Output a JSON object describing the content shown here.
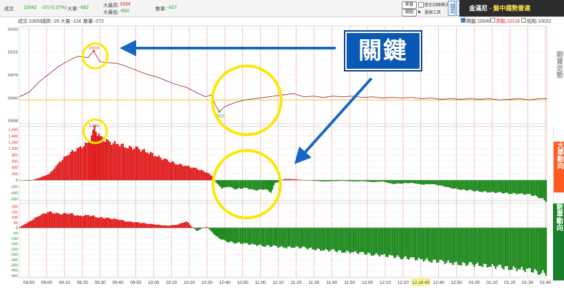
{
  "header": {
    "close_label": "成交",
    "close_value": "10042",
    "change": "-37(-0.37%)",
    "big_order_label": "大單:",
    "big_order_value": "-682",
    "big_high_label": "大最高:",
    "big_high_value": "1634",
    "big_low_label": "大最低:",
    "big_low_value": "-692",
    "small_order_label": "散單:",
    "small_order_value": "-427"
  },
  "controls": {
    "single_label": "單窗",
    "history_mode_label": "歷史訓練模式",
    "draw_label": "繪圖",
    "line_tool_label": "畫線工具",
    "settings_label": "設定",
    "exit_label": "退出"
  },
  "brand": {
    "name": "金滿尼",
    "slogan": "盤中趨勢雷達"
  },
  "subheader": {
    "trade": "成交:10050",
    "ups_downs": "漲跌:-29",
    "big": "大量:-124",
    "small": "散量:-272",
    "legend_close": "開盤:10040",
    "legend_high": "高點:10116",
    "legend_low": "低點:10022"
  },
  "side_labels": {
    "futures": "期貨走勢",
    "big": "大單動向",
    "small": "散單動向"
  },
  "annotation": {
    "text": "關鍵",
    "peak_label": "10116",
    "low_label": "10022",
    "big_peak_label": "1,634"
  },
  "chart_data": {
    "type": "line",
    "x_ticks": [
      "08:50",
      "09:00",
      "09:10",
      "09:20",
      "09:30",
      "09:40",
      "09:50",
      "10:00",
      "10:10",
      "10:20",
      "10:30",
      "10:40",
      "10:50",
      "11:00",
      "11:10",
      "11:20",
      "11:30",
      "11:40",
      "11:50",
      "12:00",
      "12:10",
      "12:20",
      "12:28:40",
      "12:40",
      "12:50",
      "01:00",
      "01:10",
      "01:20",
      "01:30",
      "01:40"
    ],
    "price": {
      "y_ticks": [
        10150,
        10115,
        10079,
        10043,
        10008
      ],
      "ylim": [
        10003,
        10155
      ],
      "ref_open": 10040,
      "high": 10116,
      "low": 10022,
      "points": [
        [
          0,
          10045
        ],
        [
          5,
          10052
        ],
        [
          10,
          10068
        ],
        [
          15,
          10080
        ],
        [
          20,
          10092
        ],
        [
          25,
          10101
        ],
        [
          30,
          10108
        ],
        [
          35,
          10106
        ],
        [
          38,
          10116
        ],
        [
          41,
          10100
        ],
        [
          45,
          10098
        ],
        [
          50,
          10097
        ],
        [
          55,
          10092
        ],
        [
          60,
          10086
        ],
        [
          65,
          10080
        ],
        [
          70,
          10076
        ],
        [
          75,
          10070
        ],
        [
          80,
          10064
        ],
        [
          85,
          10060
        ],
        [
          90,
          10052
        ],
        [
          95,
          10045
        ],
        [
          98,
          10048
        ],
        [
          100,
          10032
        ],
        [
          102,
          10022
        ],
        [
          105,
          10030
        ],
        [
          110,
          10036
        ],
        [
          115,
          10040
        ],
        [
          120,
          10042
        ],
        [
          125,
          10044
        ],
        [
          130,
          10046
        ],
        [
          135,
          10048
        ],
        [
          140,
          10050
        ],
        [
          145,
          10045
        ],
        [
          150,
          10046
        ],
        [
          155,
          10044
        ],
        [
          160,
          10046
        ],
        [
          165,
          10045
        ],
        [
          170,
          10046
        ],
        [
          175,
          10044
        ],
        [
          180,
          10045
        ],
        [
          185,
          10043
        ],
        [
          190,
          10044
        ],
        [
          195,
          10043
        ],
        [
          200,
          10044
        ],
        [
          205,
          10042
        ],
        [
          210,
          10043
        ],
        [
          215,
          10041
        ],
        [
          220,
          10042
        ],
        [
          225,
          10041
        ],
        [
          230,
          10042
        ],
        [
          235,
          10041
        ],
        [
          240,
          10042
        ],
        [
          245,
          10040
        ],
        [
          250,
          10041
        ],
        [
          255,
          10042
        ],
        [
          260,
          10040
        ],
        [
          265,
          10042
        ],
        [
          269,
          10042
        ]
      ]
    },
    "big_order": {
      "y_ticks": [
        1600,
        1400,
        1200,
        1000,
        800,
        600,
        400,
        200,
        0,
        -200,
        -400,
        -600
      ],
      "ylim": [
        -650,
        1700
      ],
      "high": 1634,
      "low": -692,
      "points": [
        [
          0,
          0
        ],
        [
          5,
          -20
        ],
        [
          10,
          80
        ],
        [
          15,
          200
        ],
        [
          20,
          560
        ],
        [
          25,
          860
        ],
        [
          30,
          1000
        ],
        [
          35,
          1200
        ],
        [
          38,
          1634
        ],
        [
          41,
          1350
        ],
        [
          45,
          1200
        ],
        [
          50,
          1150
        ],
        [
          55,
          1050
        ],
        [
          60,
          1000
        ],
        [
          65,
          900
        ],
        [
          70,
          760
        ],
        [
          75,
          620
        ],
        [
          80,
          520
        ],
        [
          85,
          450
        ],
        [
          90,
          360
        ],
        [
          95,
          260
        ],
        [
          98,
          120
        ],
        [
          100,
          -80
        ],
        [
          103,
          -260
        ],
        [
          106,
          -200
        ],
        [
          110,
          -280
        ],
        [
          115,
          -250
        ],
        [
          120,
          -320
        ],
        [
          125,
          -280
        ],
        [
          128,
          -380
        ],
        [
          130,
          -100
        ],
        [
          135,
          40
        ],
        [
          140,
          30
        ],
        [
          145,
          0
        ],
        [
          150,
          -20
        ],
        [
          155,
          -40
        ],
        [
          160,
          -30
        ],
        [
          165,
          -20
        ],
        [
          170,
          -40
        ],
        [
          175,
          -30
        ],
        [
          180,
          -60
        ],
        [
          185,
          -40
        ],
        [
          190,
          -120
        ],
        [
          195,
          -100
        ],
        [
          200,
          -90
        ],
        [
          205,
          -140
        ],
        [
          210,
          -120
        ],
        [
          215,
          -180
        ],
        [
          220,
          -250
        ],
        [
          225,
          -300
        ],
        [
          230,
          -330
        ],
        [
          235,
          -360
        ],
        [
          240,
          -380
        ],
        [
          245,
          -400
        ],
        [
          250,
          -420
        ],
        [
          255,
          -430
        ],
        [
          260,
          -460
        ],
        [
          265,
          -540
        ],
        [
          269,
          -692
        ]
      ]
    },
    "small_order": {
      "y_ticks": [
        200,
        150,
        100,
        50,
        0,
        -50,
        -100,
        -150,
        -200,
        -250,
        -300,
        -350,
        -400,
        -450
      ],
      "ylim": [
        -470,
        230
      ],
      "points": [
        [
          0,
          10
        ],
        [
          5,
          60
        ],
        [
          10,
          120
        ],
        [
          15,
          150
        ],
        [
          20,
          130
        ],
        [
          25,
          140
        ],
        [
          30,
          110
        ],
        [
          35,
          120
        ],
        [
          40,
          100
        ],
        [
          45,
          90
        ],
        [
          50,
          80
        ],
        [
          55,
          60
        ],
        [
          60,
          50
        ],
        [
          65,
          40
        ],
        [
          70,
          30
        ],
        [
          75,
          20
        ],
        [
          80,
          30
        ],
        [
          85,
          60
        ],
        [
          90,
          -30
        ],
        [
          95,
          10
        ],
        [
          98,
          -40
        ],
        [
          100,
          -80
        ],
        [
          103,
          -110
        ],
        [
          106,
          -130
        ],
        [
          110,
          -140
        ],
        [
          115,
          -150
        ],
        [
          120,
          -160
        ],
        [
          125,
          -170
        ],
        [
          130,
          -175
        ],
        [
          135,
          -185
        ],
        [
          140,
          -180
        ],
        [
          145,
          -190
        ],
        [
          150,
          -200
        ],
        [
          155,
          -210
        ],
        [
          160,
          -215
        ],
        [
          165,
          -225
        ],
        [
          170,
          -230
        ],
        [
          175,
          -240
        ],
        [
          180,
          -250
        ],
        [
          185,
          -260
        ],
        [
          190,
          -270
        ],
        [
          195,
          -280
        ],
        [
          200,
          -290
        ],
        [
          205,
          -300
        ],
        [
          210,
          -310
        ],
        [
          215,
          -320
        ],
        [
          220,
          -330
        ],
        [
          225,
          -340
        ],
        [
          230,
          -345
        ],
        [
          235,
          -350
        ],
        [
          240,
          -360
        ],
        [
          245,
          -370
        ],
        [
          250,
          -380
        ],
        [
          255,
          -390
        ],
        [
          260,
          -400
        ],
        [
          265,
          -420
        ],
        [
          269,
          -427
        ]
      ]
    }
  },
  "colors": {
    "up": "#e02020",
    "down": "#1f8a1f",
    "price_line": "#a03030",
    "grid_red": "#f2a6a6",
    "highlight": "#ffe600",
    "arrow": "#1768c4",
    "side_futures": "#9a9a9a",
    "side_big_bg": "#ff5a1f",
    "side_small_bg": "#1a7f2a"
  }
}
